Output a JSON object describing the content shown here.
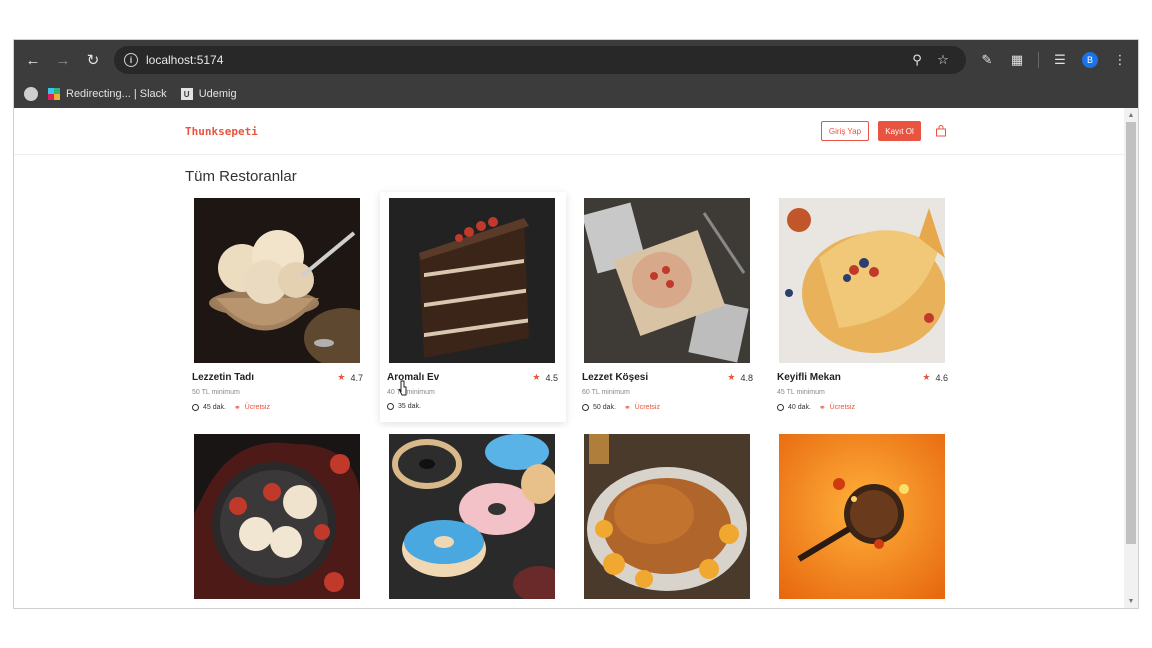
{
  "browser": {
    "url": "localhost:5174",
    "profile_initial": "B",
    "bookmarks": [
      {
        "label": "Redirecting... | Slack",
        "icon": "slack-icon"
      },
      {
        "label": "Udemig",
        "icon": "udemig-icon"
      }
    ]
  },
  "header": {
    "logo": "Thunksepeti",
    "login_label": "Giriş Yap",
    "register_label": "Kayıt Ol"
  },
  "main": {
    "title": "Tüm Restoranlar",
    "restaurants": [
      {
        "name": "Lezzetin Tadı",
        "rating": "4.7",
        "minimum": "50 TL minimum",
        "time": "45 dak.",
        "delivery": "Ücretsiz",
        "image": "ice-cream"
      },
      {
        "name": "Aromalı Ev",
        "rating": "4.5",
        "minimum": "40 TL minimum",
        "time": "35 dak.",
        "delivery": "",
        "image": "chocolate-cake"
      },
      {
        "name": "Lezzet Köşesi",
        "rating": "4.8",
        "minimum": "60 TL minimum",
        "time": "50 dak.",
        "delivery": "Ücretsiz",
        "image": "pastry"
      },
      {
        "name": "Keyifli Mekan",
        "rating": "4.6",
        "minimum": "45 TL minimum",
        "time": "40 dak.",
        "delivery": "Ücretsiz",
        "image": "crepe"
      },
      {
        "name": "",
        "rating": "",
        "minimum": "",
        "time": "",
        "delivery": "",
        "image": "strawberry-ice-cream"
      },
      {
        "name": "",
        "rating": "",
        "minimum": "",
        "time": "",
        "delivery": "",
        "image": "donuts"
      },
      {
        "name": "",
        "rating": "",
        "minimum": "",
        "time": "",
        "delivery": "",
        "image": "roast-chicken"
      },
      {
        "name": "",
        "rating": "",
        "minimum": "",
        "time": "",
        "delivery": "",
        "image": "splash-pan"
      }
    ]
  },
  "colors": {
    "brand": "#e8543f",
    "chrome": "#3c3c3c"
  }
}
